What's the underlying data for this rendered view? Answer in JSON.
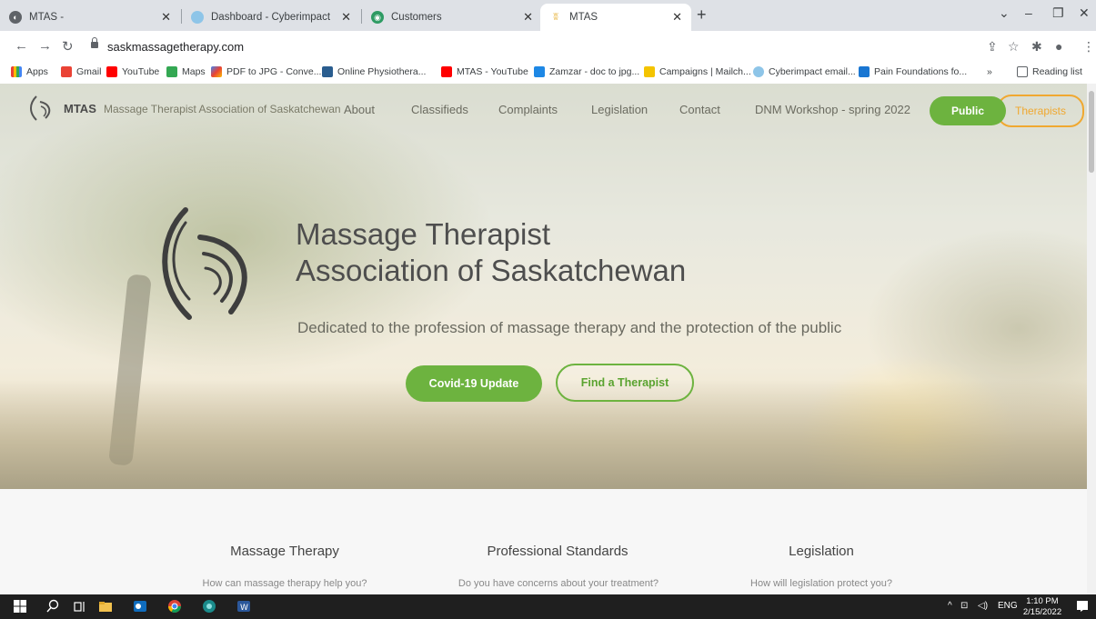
{
  "browser": {
    "tabs": [
      {
        "title": "MTAS -",
        "active": false
      },
      {
        "title": "Dashboard - Cyberimpact",
        "active": false
      },
      {
        "title": "Customers",
        "active": false
      },
      {
        "title": "MTAS",
        "active": true
      }
    ],
    "url": "saskmassagetherapy.com",
    "bookmarks": [
      "Apps",
      "Gmail",
      "YouTube",
      "Maps",
      "PDF to JPG - Conve...",
      "Online Physiothera...",
      "MTAS - YouTube",
      "Zamzar - doc to jpg...",
      "Campaigns | Mailch...",
      "Cyberimpact email...",
      "Pain Foundations fo..."
    ],
    "bookmarks_overflow": "»",
    "reading_list": "Reading list"
  },
  "site": {
    "brand": "MTAS",
    "tagline": "Massage Therapist Association of Saskatchewan",
    "nav": [
      "About",
      "Classifieds",
      "Complaints",
      "Legislation",
      "Contact",
      "DNM Workshop - spring 2022"
    ],
    "public_label": "Public",
    "therapists_label": "Therapists",
    "hero": {
      "title_line1": "Massage Therapist",
      "title_line2": "Association of Saskatchewan",
      "subtitle": "Dedicated to the profession of massage therapy and the protection of the public",
      "covid_button": "Covid-19 Update",
      "find_button": "Find a Therapist"
    },
    "columns": [
      {
        "title": "Massage Therapy",
        "subtitle": "How can massage therapy help you?"
      },
      {
        "title": "Professional Standards",
        "subtitle": "Do you have concerns about your treatment?"
      },
      {
        "title": "Legislation",
        "subtitle": "How will legislation protect you?"
      }
    ]
  },
  "taskbar": {
    "lang": "ENG",
    "time": "1:10 PM",
    "date": "2/15/2022"
  },
  "colors": {
    "green": "#6db33f",
    "orange": "#f0a830"
  }
}
